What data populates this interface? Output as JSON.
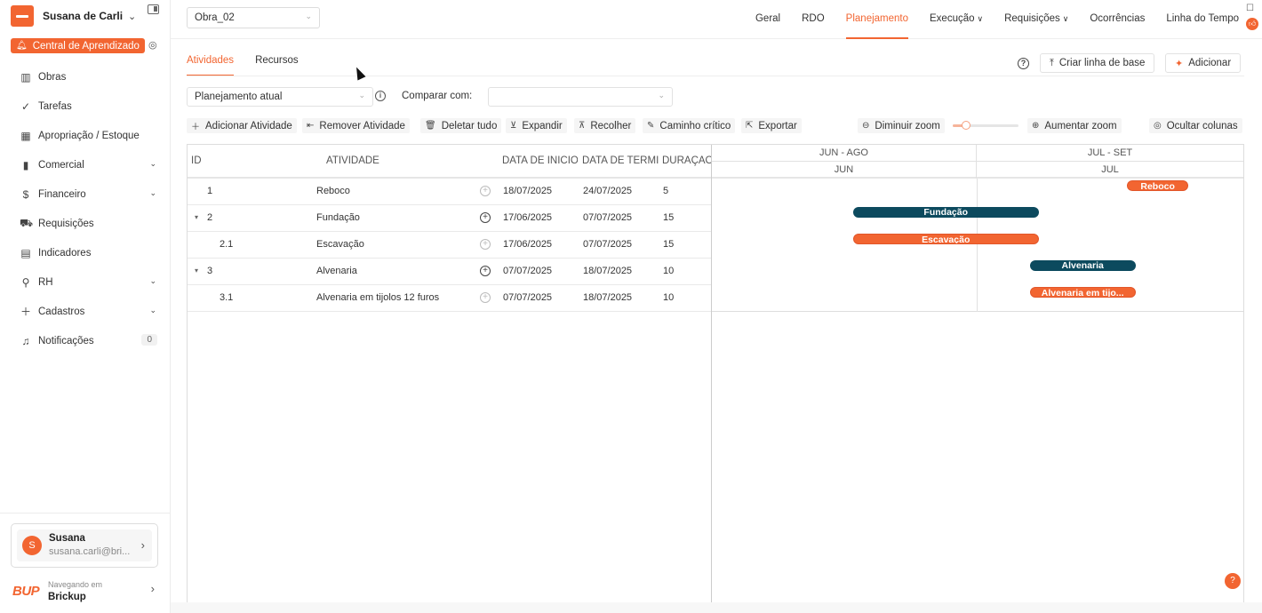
{
  "sidebar": {
    "user_name": "Susana de Carli",
    "learning_center": "Central de Aprendizado",
    "items": [
      {
        "label": "Obras",
        "icon": "building-icon"
      },
      {
        "label": "Tarefas",
        "icon": "check-circle-icon"
      },
      {
        "label": "Apropriação / Estoque",
        "icon": "grid-icon"
      },
      {
        "label": "Comercial",
        "icon": "barcode-icon"
      },
      {
        "label": "Financeiro",
        "icon": "dollar-icon"
      },
      {
        "label": "Requisições",
        "icon": "cart-icon"
      },
      {
        "label": "Indicadores",
        "icon": "chart-icon"
      },
      {
        "label": "RH",
        "icon": "person-icon"
      },
      {
        "label": "Cadastros",
        "icon": "plus-icon"
      },
      {
        "label": "Notificações",
        "icon": "bell-icon",
        "count": "0"
      }
    ],
    "account": {
      "avatar": "S",
      "name": "Susana",
      "email": "susana.carli@bri..."
    },
    "navigating": {
      "label": "Navegando em",
      "brand": "Brickup",
      "logo": "BUP"
    }
  },
  "topbar": {
    "project": "Obra_02",
    "tabs": [
      {
        "label": "Geral"
      },
      {
        "label": "RDO"
      },
      {
        "label": "Planejamento",
        "active": true
      },
      {
        "label": "Execução",
        "dropdown": true
      },
      {
        "label": "Requisições",
        "dropdown": true
      },
      {
        "label": "Ocorrências"
      },
      {
        "label": "Linha do Tempo"
      }
    ]
  },
  "content": {
    "subtabs": [
      "Atividades",
      "Recursos"
    ],
    "baseline_button": "Criar linha de base",
    "add_button": "Adicionar",
    "plan_select": "Planejamento atual",
    "compare_label": "Comparar com:",
    "compare_value": "",
    "toolbar": {
      "add_activity": "Adicionar Atividade",
      "remove_activity": "Remover Atividade",
      "delete_all": "Deletar tudo",
      "expand": "Expandir",
      "collapse": "Recolher",
      "critical_path": "Caminho crítico",
      "export": "Exportar",
      "zoom_out": "Diminuir zoom",
      "zoom_in": "Aumentar zoom",
      "hide_columns": "Ocultar colunas",
      "zoom_level": 0.2
    },
    "grid": {
      "columns": {
        "id": "ID",
        "activity": "ATIVIDADE",
        "start": "DATA DE INÍCIO",
        "end": "DATA DE TÉRMIN",
        "duration": "DURAÇÃO"
      },
      "rows": [
        {
          "id": "1",
          "name": "Reboco",
          "start": "18/07/2025",
          "end": "24/07/2025",
          "duration": "5",
          "expander": "",
          "indent": false,
          "parent": false
        },
        {
          "id": "2",
          "name": "Fundação",
          "start": "17/06/2025",
          "end": "07/07/2025",
          "duration": "15",
          "expander": "▾",
          "indent": false,
          "parent": true
        },
        {
          "id": "2.1",
          "name": "Escavação",
          "start": "17/06/2025",
          "end": "07/07/2025",
          "duration": "15",
          "expander": "",
          "indent": true,
          "parent": false
        },
        {
          "id": "3",
          "name": "Alvenaria",
          "start": "07/07/2025",
          "end": "18/07/2025",
          "duration": "10",
          "expander": "▾",
          "indent": false,
          "parent": true
        },
        {
          "id": "3.1",
          "name": "Alvenaria em tijolos 12 furos",
          "start": "07/07/2025",
          "end": "18/07/2025",
          "duration": "10",
          "expander": "",
          "indent": true,
          "parent": false
        }
      ]
    },
    "timeline": {
      "top": [
        "JUN - AGO",
        "JUL - SET"
      ],
      "bottom": [
        "JUN",
        "JUL"
      ],
      "bars": [
        {
          "label": "Reboco",
          "start": "2025-07-18",
          "end": "2025-07-24",
          "type": "task"
        },
        {
          "label": "Fundação",
          "start": "2025-06-17",
          "end": "2025-07-07",
          "type": "parent"
        },
        {
          "label": "Escavação",
          "start": "2025-06-17",
          "end": "2025-07-07",
          "type": "task"
        },
        {
          "label": "Alvenaria",
          "start": "2025-07-07",
          "end": "2025-07-18",
          "type": "parent"
        },
        {
          "label": "Alvenaria em tijo...",
          "start": "2025-07-07",
          "end": "2025-07-18",
          "type": "task"
        }
      ]
    }
  },
  "colors": {
    "accent": "#f26531",
    "parent_bar": "#0c4a5e"
  }
}
